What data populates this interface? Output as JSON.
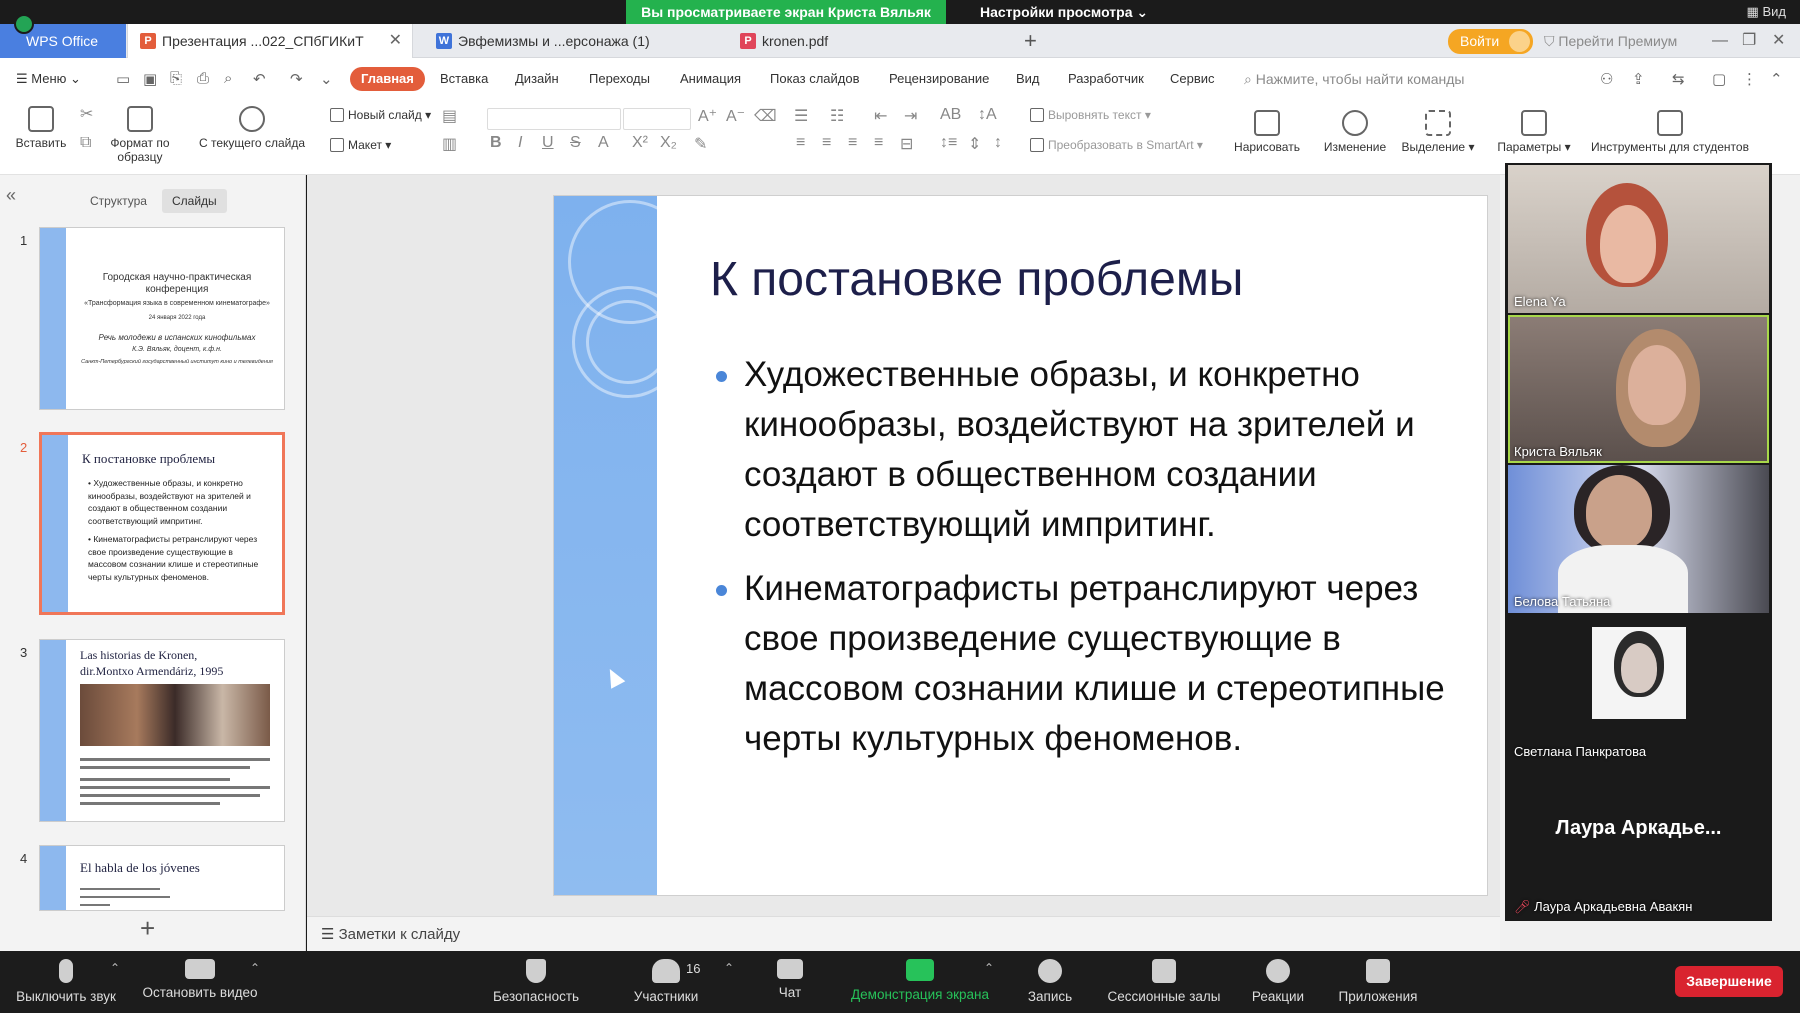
{
  "zoom": {
    "share_banner": "Вы просматриваете экран Криста Вяльяк",
    "view_options": "Настройки просмотра",
    "view_corner": "Вид",
    "toolbar": {
      "mute": "Выключить звук",
      "stop_video": "Остановить видео",
      "security": "Безопасность",
      "participants": "Участники",
      "participants_count": "16",
      "chat": "Чат",
      "share_screen": "Демонстрация экрана",
      "record": "Запись",
      "breakout": "Сессионные залы",
      "reactions": "Реакции",
      "apps": "Приложения",
      "end": "Завершение"
    },
    "gallery": [
      {
        "name": "Elena Ya"
      },
      {
        "name": "Криста Вяльяк"
      },
      {
        "name": "Белова Татьяна"
      },
      {
        "name": "Светлана Панкратова"
      },
      {
        "name": "Лаура Аркадьевна Авакян",
        "display": "Лаура  Аркадье..."
      }
    ]
  },
  "wps": {
    "home_tab": "WPS Office",
    "tabs": [
      {
        "label": "Презентация ...022_СПбГИКиТ"
      },
      {
        "label": "Эвфемизмы и ...ерсонажа (1)"
      },
      {
        "label": "kronen.pdf"
      }
    ],
    "login": "Войти",
    "premium": "Перейти Премиум",
    "menu_label": "Меню",
    "menu_tabs": [
      "Главная",
      "Вставка",
      "Дизайн",
      "Переходы",
      "Анимация",
      "Показ слайдов",
      "Рецензирование",
      "Вид",
      "Разработчик",
      "Сервис"
    ],
    "search_placeholder": "Нажмите, чтобы найти команды",
    "ribbon": {
      "paste": "Вставить",
      "format_painter": "Формат по образцу",
      "from_current": "С текущего слайда",
      "new_slide": "Новый слайд",
      "layout": "Макет",
      "align_text": "Выровнять текст",
      "convert_smartart": "Преобразовать в SmartArt",
      "draw": "Нарисовать",
      "change": "Изменение",
      "select": "Выделение",
      "params": "Параметры",
      "student_tools": "Инструменты для студентов"
    },
    "pane_tabs": [
      "Структура",
      "Слайды"
    ],
    "notes": "Заметки к слайду"
  },
  "thumbs": {
    "s1": {
      "num": "1",
      "title": "Городская научно-практическая конференция",
      "subtitle": "«Трансформация языка в современном кинематографе»",
      "date": "24 января 2022 года",
      "talk": "Речь молодежи в испанских кинофильмах",
      "author": "К.Э. Вяльяк, доцент, к.ф.н.",
      "org": "Санкт-Петербургский государственный институт кино и телевидения"
    },
    "s2": {
      "num": "2",
      "title": "К постановке проблемы",
      "b1": "Художественные образы, и конкретно кинообразы, воздействуют на зрителей и создают в общественном создании соответствующий импритинг.",
      "b2": "Кинематографисты ретранслируют через свое произведение существующие в массовом сознании клише и стереотипные черты культурных феноменов."
    },
    "s3": {
      "num": "3",
      "title1": "Las historias de Kronen,",
      "title2": "dir.Montxo Armendáriz, 1995"
    },
    "s4": {
      "num": "4",
      "title": "El habla de los jóvenes"
    }
  },
  "slide": {
    "title": "К постановке проблемы",
    "bullets": [
      "Художественные образы, и конкретно кинообразы, воздействуют на зрителей и создают в общественном создании соответствующий импритинг.",
      "Кинематографисты ретранслируют через свое произведение существующие в массовом сознании клише и стереотипные черты культурных феноменов."
    ]
  },
  "colors": {
    "wps_accent": "#e35d3b",
    "wps_home": "#4a7fe0",
    "zoom_green": "#24b24e",
    "end_red": "#d9232f",
    "slide_bar": "#8db8ee"
  }
}
